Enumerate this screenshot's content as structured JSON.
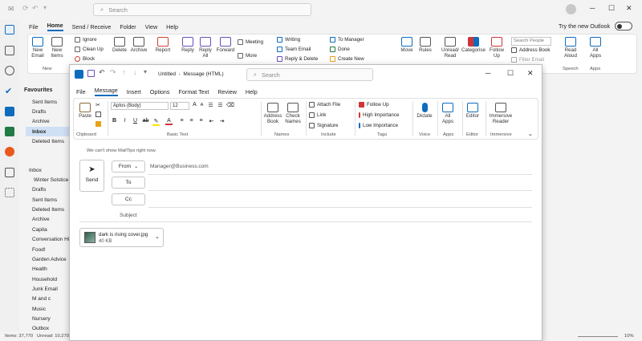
{
  "main": {
    "search_placeholder": "Search",
    "menu": [
      "File",
      "Home",
      "Send / Receive",
      "Folder",
      "View",
      "Help"
    ],
    "try_new": "Try the new Outlook",
    "ribbon": {
      "new_email": "New\nEmail",
      "new_items": "New\nItems",
      "group_new": "New",
      "ignore": "Ignore",
      "clean_up": "Clean Up",
      "block": "Block",
      "delete": "Delete",
      "archive": "Archive",
      "report": "Report",
      "reply": "Reply",
      "reply_all": "Reply\nAll",
      "forward": "Forward",
      "meeting": "Meeting",
      "more": "More",
      "writing": "Writing",
      "team_email": "Team Email",
      "reply_delete": "Reply & Delete",
      "to_manager": "To Manager",
      "done": "Done",
      "create_new": "Create New",
      "move": "Move",
      "rules": "Rules",
      "unread_read": "Unread/\nRead",
      "categorise": "Categorise",
      "follow_up": "Follow\nUp",
      "search_people": "Search People",
      "address_book": "Address Book",
      "filter_email": "Filter Email",
      "read_aloud": "Read\nAloud",
      "group_speech": "Speech",
      "all_apps": "All\nApps",
      "group_apps": "Apps"
    },
    "folders": {
      "favourites": "Favourites",
      "fav_items": [
        "Sent Items",
        "Drafts",
        "Archive",
        "Inbox",
        "Deleted Items"
      ],
      "inbox": "Inbox",
      "inbox_items": [
        "Winter Solstice",
        "Drafts",
        "Sent Items",
        "Deleted Items",
        "Archive",
        "Capita",
        "Conversation History",
        "Food!",
        "Garden Advice",
        "Health",
        "Household",
        "Junk Email",
        "M and c",
        "Music",
        "Nursery",
        "Outbox"
      ]
    },
    "status": {
      "items": "Items: 37,770",
      "unread": "Unread: 10,270",
      "zoom": "10%"
    }
  },
  "compose": {
    "title": "Untitled  -  Message (HTML)",
    "search_placeholder": "Search",
    "menu": [
      "File",
      "Message",
      "Insert",
      "Options",
      "Format Text",
      "Review",
      "Help"
    ],
    "ribbon": {
      "paste": "Paste",
      "group_clipboard": "Clipboard",
      "font": "Aptos (Body)",
      "size": "12",
      "group_basic_text": "Basic Text",
      "address_book": "Address\nBook",
      "check_names": "Check\nNames",
      "group_names": "Names",
      "attach_file": "Attach File",
      "link": "Link",
      "signature": "Signature",
      "group_include": "Include",
      "follow_up": "Follow Up",
      "high_importance": "High Importance",
      "low_importance": "Low Importance",
      "group_tags": "Tags",
      "dictate": "Dictate",
      "group_voice": "Voice",
      "all_apps": "All\nApps",
      "group_apps": "Apps",
      "editor": "Editor",
      "group_editor": "Editor",
      "immersive_reader": "Immersive\nReader",
      "group_immersive": "Immersive"
    },
    "mailtips": "We can't show MailTips right now.",
    "send": "Send",
    "from_label": "From",
    "from_value": "Manager@Business.com",
    "to_label": "To",
    "cc_label": "Cc",
    "subject_label": "Subject",
    "attachment": {
      "name": "dark is rising cover.jpg",
      "size": "40 KB"
    }
  },
  "colors": {
    "accent": "#0f6cbd",
    "outlook_blue": "#0f6cbd",
    "purple": "#6b4fbb"
  }
}
